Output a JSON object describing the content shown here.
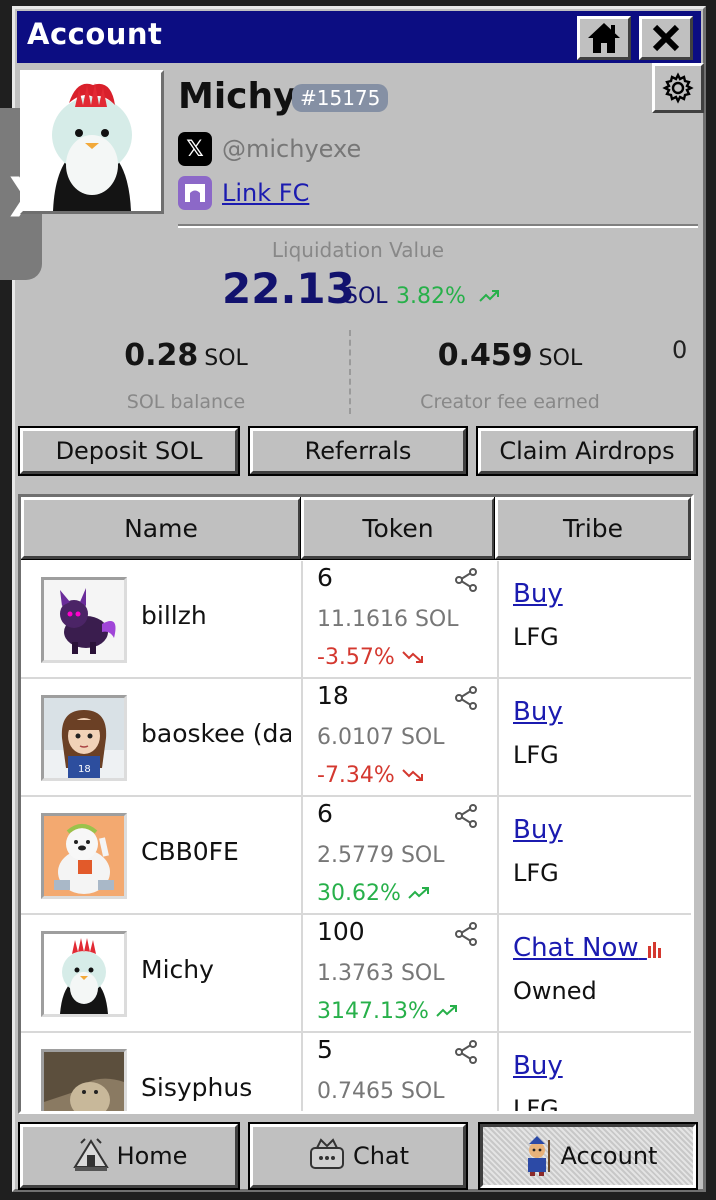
{
  "window": {
    "title": "Account"
  },
  "profile": {
    "name": "Michy",
    "id_badge": "#15175",
    "x_handle": "@michyexe",
    "fc_link": "Link FC"
  },
  "liquidation": {
    "label": "Liquidation Value",
    "value": "22.13",
    "unit": "SOL",
    "change": "3.82%"
  },
  "stats": {
    "sol_balance": {
      "value": "0.28",
      "unit": "SOL",
      "label": "SOL balance"
    },
    "creator_fee": {
      "value": "0.459",
      "unit": "SOL",
      "label": "Creator fee earned"
    },
    "extra_value": "0"
  },
  "actions": {
    "deposit": "Deposit SOL",
    "referrals": "Referrals",
    "claim": "Claim Airdrops"
  },
  "table": {
    "headers": [
      "Name",
      "Token",
      "Tribe"
    ],
    "rows": [
      {
        "name": "billzh",
        "tokens": "6",
        "price": "11.1616 SOL",
        "change": "-3.57%",
        "trend": "down",
        "tribe_action": "Buy",
        "tribe_status": "LFG"
      },
      {
        "name": "baoskee (da",
        "tokens": "18",
        "price": "6.0107 SOL",
        "change": "-7.34%",
        "trend": "down",
        "tribe_action": "Buy",
        "tribe_status": "LFG"
      },
      {
        "name": "CBB0FE",
        "tokens": "6",
        "price": "2.5779 SOL",
        "change": "30.62%",
        "trend": "up",
        "tribe_action": "Buy",
        "tribe_status": "LFG"
      },
      {
        "name": "Michy",
        "tokens": "100",
        "price": "1.3763 SOL",
        "change": "3147.13%",
        "trend": "up",
        "tribe_action": "Chat Now",
        "tribe_status": "Owned"
      },
      {
        "name": "Sisyphus",
        "tokens": "5",
        "price": "0.7465 SOL",
        "change": "",
        "trend": "",
        "tribe_action": "Buy",
        "tribe_status": "LFG"
      }
    ]
  },
  "nav": {
    "home": "Home",
    "chat": "Chat",
    "account": "Account"
  },
  "colors": {
    "titlebar": "#0c0d82",
    "window": "#c0c0c0",
    "up": "#27b04a",
    "down": "#d4382f",
    "link": "#1b1bb0"
  },
  "icons": [
    "home-icon",
    "close-icon",
    "gear-icon",
    "x-logo-icon",
    "farcaster-icon",
    "trend-up-icon",
    "trend-down-icon",
    "share-icon",
    "chart-bars-icon"
  ]
}
